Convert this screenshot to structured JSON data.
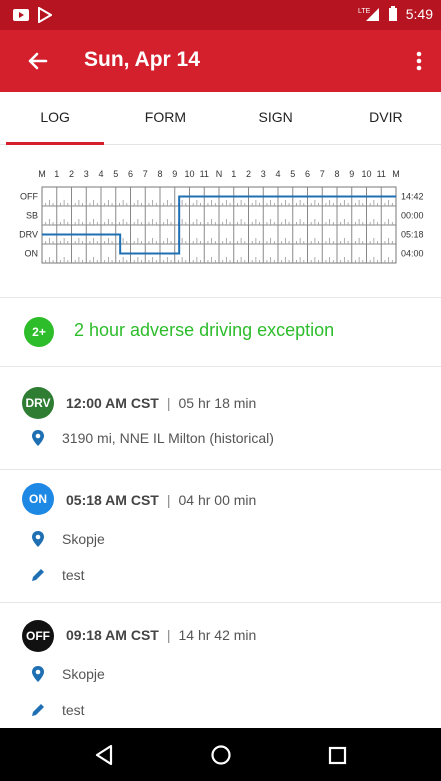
{
  "status_bar": {
    "time": "5:49",
    "network": "LTE"
  },
  "app_bar": {
    "title": "Sun, Apr 14"
  },
  "tabs": [
    {
      "label": "LOG",
      "active": true
    },
    {
      "label": "FORM",
      "active": false
    },
    {
      "label": "SIGN",
      "active": false
    },
    {
      "label": "DVIR",
      "active": false
    }
  ],
  "log_chart": {
    "hour_labels": [
      "M",
      "1",
      "2",
      "3",
      "4",
      "5",
      "6",
      "7",
      "8",
      "9",
      "10",
      "11",
      "N",
      "1",
      "2",
      "3",
      "4",
      "5",
      "6",
      "7",
      "8",
      "9",
      "10",
      "11",
      "M"
    ],
    "rows": [
      "OFF",
      "SB",
      "DRV",
      "ON"
    ],
    "totals": [
      "14:42",
      "00:00",
      "05:18",
      "04:00"
    ],
    "segments": [
      {
        "status": "DRV",
        "start_h": 0.0,
        "end_h": 5.3
      },
      {
        "status": "ON",
        "start_h": 5.3,
        "end_h": 9.3
      },
      {
        "status": "OFF",
        "start_h": 9.3,
        "end_h": 24.0
      }
    ],
    "line_color": "#1f6fb3"
  },
  "exception": {
    "badge": "2+",
    "text": "2 hour adverse driving exception",
    "color": "#2dbd2b"
  },
  "events": [
    {
      "badge": "DRV",
      "badge_color": "#2e7d32",
      "time": "12:00 AM CST",
      "separator": "|",
      "duration": "05 hr 18 min",
      "location": "3190 mi, NNE IL Milton (historical)",
      "note": ""
    },
    {
      "badge": "ON",
      "badge_color": "#1e88e5",
      "time": "05:18 AM CST",
      "separator": "|",
      "duration": "04 hr 00 min",
      "location": "Skopje",
      "note": "test"
    },
    {
      "badge": "OFF",
      "badge_color": "#111111",
      "time": "09:18 AM CST",
      "separator": "|",
      "duration": "14 hr 42 min",
      "location": "Skopje",
      "note": "test"
    }
  ]
}
